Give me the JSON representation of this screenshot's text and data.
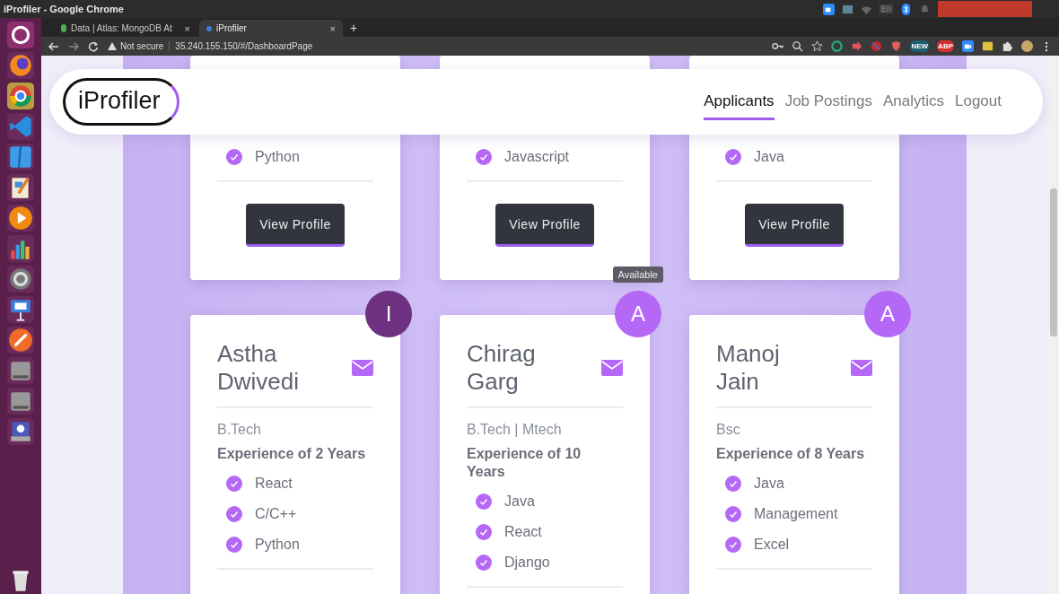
{
  "os_bar": {
    "title": "iProfiler - Google Chrome",
    "keyboard": "En"
  },
  "browser": {
    "tabs": [
      {
        "title": "Data | Atlas: MongoDB At",
        "close": "×",
        "selected": false
      },
      {
        "title": "iProfiler",
        "close": "×",
        "selected": true
      }
    ],
    "new_tab": "+",
    "security": "Not secure",
    "url": "35.240.155.150/#/DashboardPage",
    "extensions": [
      {
        "kind": "ring",
        "color": "#1fae7a"
      },
      {
        "kind": "arrow",
        "color": "#e8505b"
      },
      {
        "kind": "circle",
        "color": "#c62828"
      },
      {
        "kind": "shield",
        "color": "#e06060"
      },
      {
        "kind": "label",
        "text": "NEW",
        "color": "#1d5f6e"
      },
      {
        "kind": "label",
        "text": "ABP",
        "color": "#d32f2f"
      },
      {
        "kind": "camera",
        "color": "#2d8cff"
      },
      {
        "kind": "square",
        "color": "#e2c23c"
      }
    ]
  },
  "nav": {
    "logo": "iProfiler",
    "links": [
      {
        "label": "Applicants",
        "selected": true
      },
      {
        "label": "Job Postings",
        "selected": false
      },
      {
        "label": "Analytics",
        "selected": false
      },
      {
        "label": "Logout",
        "selected": false
      }
    ]
  },
  "top_cards": [
    {
      "skills": [
        "Python"
      ],
      "button": "View Profile"
    },
    {
      "skills": [
        "Javascript"
      ],
      "button": "View Profile"
    },
    {
      "skills": [
        "Java"
      ],
      "button": "View Profile"
    }
  ],
  "applicants": [
    {
      "badge": {
        "letter": "I",
        "color": "#6e3080"
      },
      "name": "Astha Dwivedi",
      "degree": "B.Tech",
      "experience": "Experience of 2 Years",
      "skills": [
        "React",
        "C/C++",
        "Python"
      ]
    },
    {
      "badge": {
        "letter": "A",
        "color": "#b468f5"
      },
      "tooltip": "Available",
      "name": "Chirag Garg",
      "degree": "B.Tech | Mtech",
      "experience": "Experience of 10 Years",
      "skills": [
        "Java",
        "React",
        "Django"
      ]
    },
    {
      "badge": {
        "letter": "A",
        "color": "#b468f5"
      },
      "name": "Manoj Jain",
      "degree": "Bsc",
      "experience": "Experience of 8 Years",
      "skills": [
        "Java",
        "Management",
        "Excel"
      ]
    }
  ]
}
